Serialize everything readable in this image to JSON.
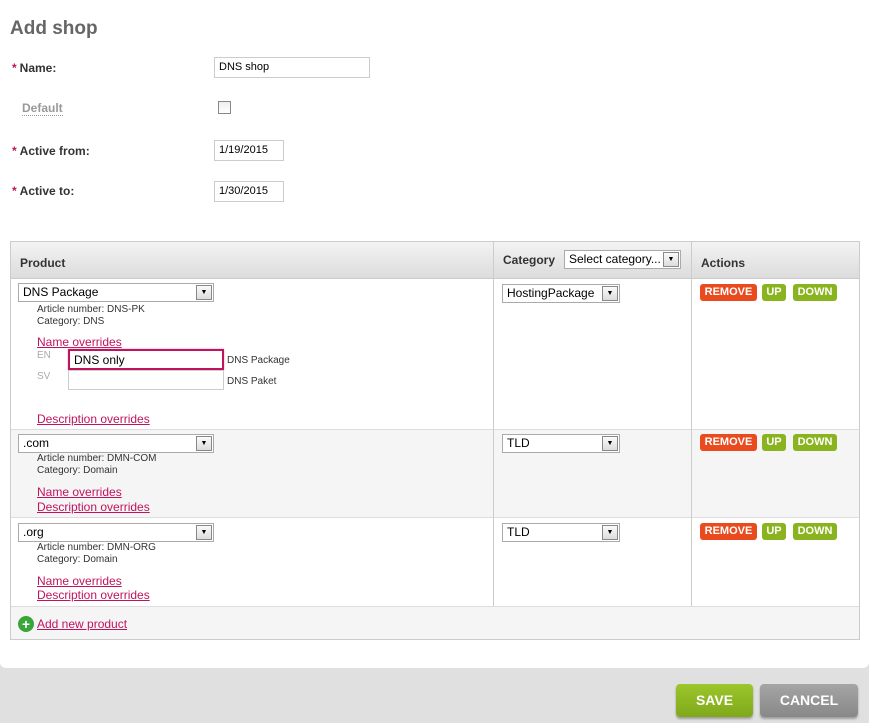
{
  "title": "Add shop",
  "form": {
    "name_label": "Name:",
    "name_value": "DNS shop",
    "default_label": "Default",
    "default_checked": false,
    "active_from_label": "Active from:",
    "active_from_value": "1/19/2015",
    "active_to_label": "Active to:",
    "active_to_value": "1/30/2015",
    "required_mark": "*"
  },
  "table": {
    "headers": {
      "product": "Product",
      "category": "Category",
      "category_filter": "Select category...",
      "actions": "Actions"
    },
    "rows": [
      {
        "product": "DNS Package",
        "article": "Article number: DNS-PK",
        "category_text": "Category: DNS",
        "category": "HostingPackage",
        "name_overrides": "Name overrides",
        "description_overrides": "Description overrides",
        "overrides": [
          {
            "lang": "EN",
            "value": "DNS only",
            "default": "DNS Package"
          },
          {
            "lang": "SV",
            "value": "",
            "default": "DNS Paket"
          }
        ]
      },
      {
        "product": ".com",
        "article": "Article number: DMN-COM",
        "category_text": "Category: Domain",
        "category": "TLD",
        "name_overrides": "Name overrides",
        "description_overrides": "Description overrides"
      },
      {
        "product": ".org",
        "article": "Article number: DMN-ORG",
        "category_text": "Category: Domain",
        "category": "TLD",
        "name_overrides": "Name overrides",
        "description_overrides": "Description overrides"
      }
    ],
    "actions": {
      "remove": "REMOVE",
      "up": "UP",
      "down": "DOWN"
    },
    "add_new": "Add new product"
  },
  "footer": {
    "save": "SAVE",
    "cancel": "CANCEL"
  },
  "colors": {
    "accent": "#c0135e",
    "remove": "#e94b1f",
    "green": "#8ab41f"
  }
}
